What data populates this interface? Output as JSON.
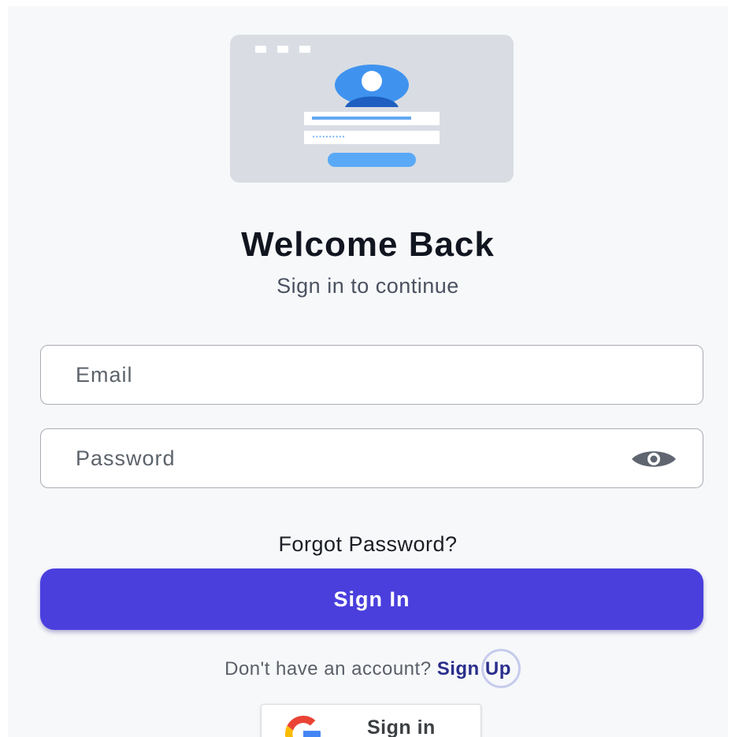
{
  "header": {
    "title": "Welcome Back",
    "subtitle": "Sign in to continue"
  },
  "form": {
    "email_placeholder": "Email",
    "email_value": "",
    "password_placeholder": "Password",
    "password_value": "",
    "forgot_label": "Forgot Password?",
    "submit_label": "Sign In"
  },
  "signup": {
    "prompt": "Don't have an account?",
    "link_label": "Sign Up"
  },
  "google": {
    "label": "Sign in"
  },
  "icons": {
    "illustration": "login-illustration",
    "visibility": "eye-icon",
    "google": "google-logo-icon"
  },
  "colors": {
    "primary": "#4a3fdd",
    "link": "#2a2f8c",
    "accent_blue": "#5aa9f7"
  },
  "illustration": {
    "password_mask": "••••••••••"
  }
}
